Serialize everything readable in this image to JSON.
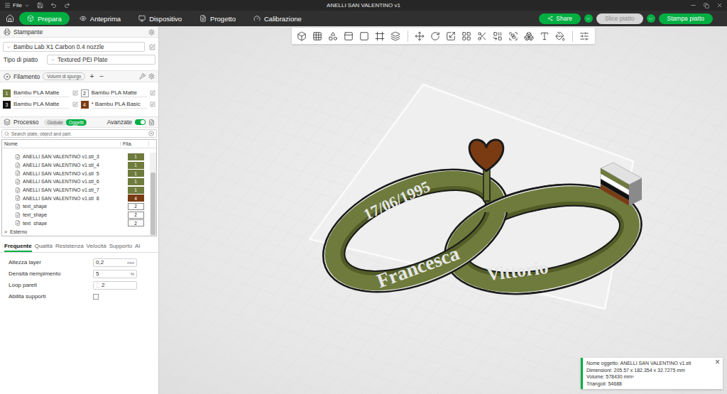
{
  "window": {
    "title": "ANELLI SAN VALENTINO v1",
    "menu": "File"
  },
  "tabs": [
    {
      "label": "Prepara",
      "selected": true
    },
    {
      "label": "Anteprima",
      "selected": false
    },
    {
      "label": "Dispositivo",
      "selected": false
    },
    {
      "label": "Progetto",
      "selected": false
    },
    {
      "label": "Calibrazione",
      "selected": false
    }
  ],
  "actions": [
    {
      "label": "Share",
      "disabled": false,
      "with_menu": false
    },
    {
      "label": "Slice piatto",
      "disabled": true,
      "with_menu": true
    },
    {
      "label": "Stampa piatto",
      "disabled": false,
      "with_menu": true
    }
  ],
  "printer": {
    "title": "Stampante",
    "model": "Bambu Lab X1 Carbon 0.4 nozzle",
    "plate_label": "Tipo di piatto",
    "plate": "Textured PEI Plate"
  },
  "filament": {
    "title": "Filamento",
    "purge_button": "Volumi di spurgo",
    "add": "+",
    "remove": "−",
    "items": [
      {
        "index": "1",
        "name": "Bambu PLA Matte",
        "color": "#6e7b3c"
      },
      {
        "index": "2",
        "name": "Bambu PLA Matte",
        "color": "#ffffff"
      },
      {
        "index": "3",
        "name": "Bambu PLA Matte",
        "color": "#111111"
      },
      {
        "index": "4",
        "name": "* Bambu PLA Basic",
        "color": "#7b3b12"
      }
    ]
  },
  "process": {
    "title": "Processo",
    "scopes": [
      {
        "label": "Globale",
        "selected": false
      },
      {
        "label": "Oggetti",
        "selected": true
      }
    ],
    "advanced_label": "Avanzate",
    "advanced_on": true,
    "search_placeholder": "Search plate, object and part.",
    "columns": [
      "Nome",
      "Fila."
    ],
    "rows": [
      {
        "name": "ANELLI SAN VALENTINO v1.stl_3",
        "filament": "1",
        "color": "#6e7b3c",
        "selected": false
      },
      {
        "name": "ANELLI SAN VALENTINO v1.stl_4",
        "filament": "1",
        "color": "#6e7b3c",
        "selected": false
      },
      {
        "name": "ANELLI SAN VALENTINO v1.stl_5",
        "filament": "1",
        "color": "#6e7b3c",
        "selected": false
      },
      {
        "name": "ANELLI SAN VALENTINO v1.stl_6",
        "filament": "1",
        "color": "#6e7b3c",
        "selected": false
      },
      {
        "name": "ANELLI SAN VALENTINO v1.stl_7",
        "filament": "1",
        "color": "#6e7b3c",
        "selected": false
      },
      {
        "name": "ANELLI SAN VALENTINO v1.stl_8",
        "filament": "4",
        "color": "#7b3b12",
        "selected": false
      },
      {
        "name": "text_shape",
        "filament": "2",
        "color": "#ffffff",
        "selected": false
      },
      {
        "name": "text_shape",
        "filament": "2",
        "color": "#ffffff",
        "selected": false
      },
      {
        "name": "text_shape",
        "filament": "2",
        "color": "#ffffff",
        "selected": false
      }
    ],
    "group": {
      "label": "Esterno",
      "toggle": ">",
      "expanded": false
    },
    "setting_tabs": [
      {
        "label": "Frequente",
        "selected": true
      },
      {
        "label": "Qualità",
        "selected": false
      },
      {
        "label": "Resistenza",
        "selected": false
      },
      {
        "label": "Velocità",
        "selected": false
      },
      {
        "label": "Supporto",
        "selected": false
      },
      {
        "label": "Al",
        "selected": false
      }
    ],
    "settings": [
      {
        "kind": "field",
        "label": "Altezza layer",
        "value": "0,2",
        "unit": "mm"
      },
      {
        "kind": "field",
        "label": "Densità riempimento",
        "value": "5",
        "unit": "%"
      },
      {
        "kind": "spinner",
        "label": "Loop pareti",
        "value": "2"
      },
      {
        "kind": "checkbox",
        "label": "Abilita supporti",
        "checked": false
      }
    ]
  },
  "scene": {
    "engravings": [
      {
        "text": "17/06/1995"
      },
      {
        "text": "Francesca"
      },
      {
        "text": "Vittorio"
      }
    ]
  },
  "info": {
    "lines": [
      "Nome oggetto: ANELLI SAN VALENTINO v1.stl",
      "Dimensioni: 205.57 x 182.354 x 32.7275 mm",
      "Volume: 578430 mm³",
      "Triangoli: 54688"
    ],
    "close": "×"
  }
}
